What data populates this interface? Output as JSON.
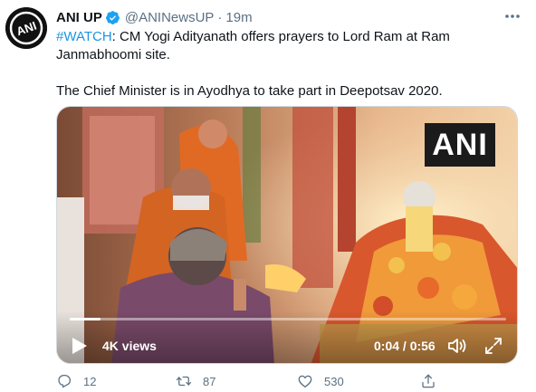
{
  "tweet": {
    "name": "ANI UP",
    "handle": "@ANINewsUP",
    "separator": "·",
    "time": "19m",
    "hashtag": "#WATCH",
    "text_line1": ": CM Yogi Adityanath offers prayers to Lord Ram at Ram Janmabhoomi site.",
    "text_line2": "The Chief Minister is in Ayodhya to take part in Deepotsav 2020.",
    "avatar_text": "ANI",
    "more_icon": "more-horizontal-icon"
  },
  "video": {
    "watermark": "ANI",
    "views": "4K views",
    "timecode": "0:04 / 0:56",
    "progress": 0.07
  },
  "actions": {
    "replies": "12",
    "retweets": "87",
    "likes": "530"
  },
  "colors": {
    "accent": "#1b95e0",
    "muted": "#5b7083",
    "verified": "#1da1f2"
  }
}
